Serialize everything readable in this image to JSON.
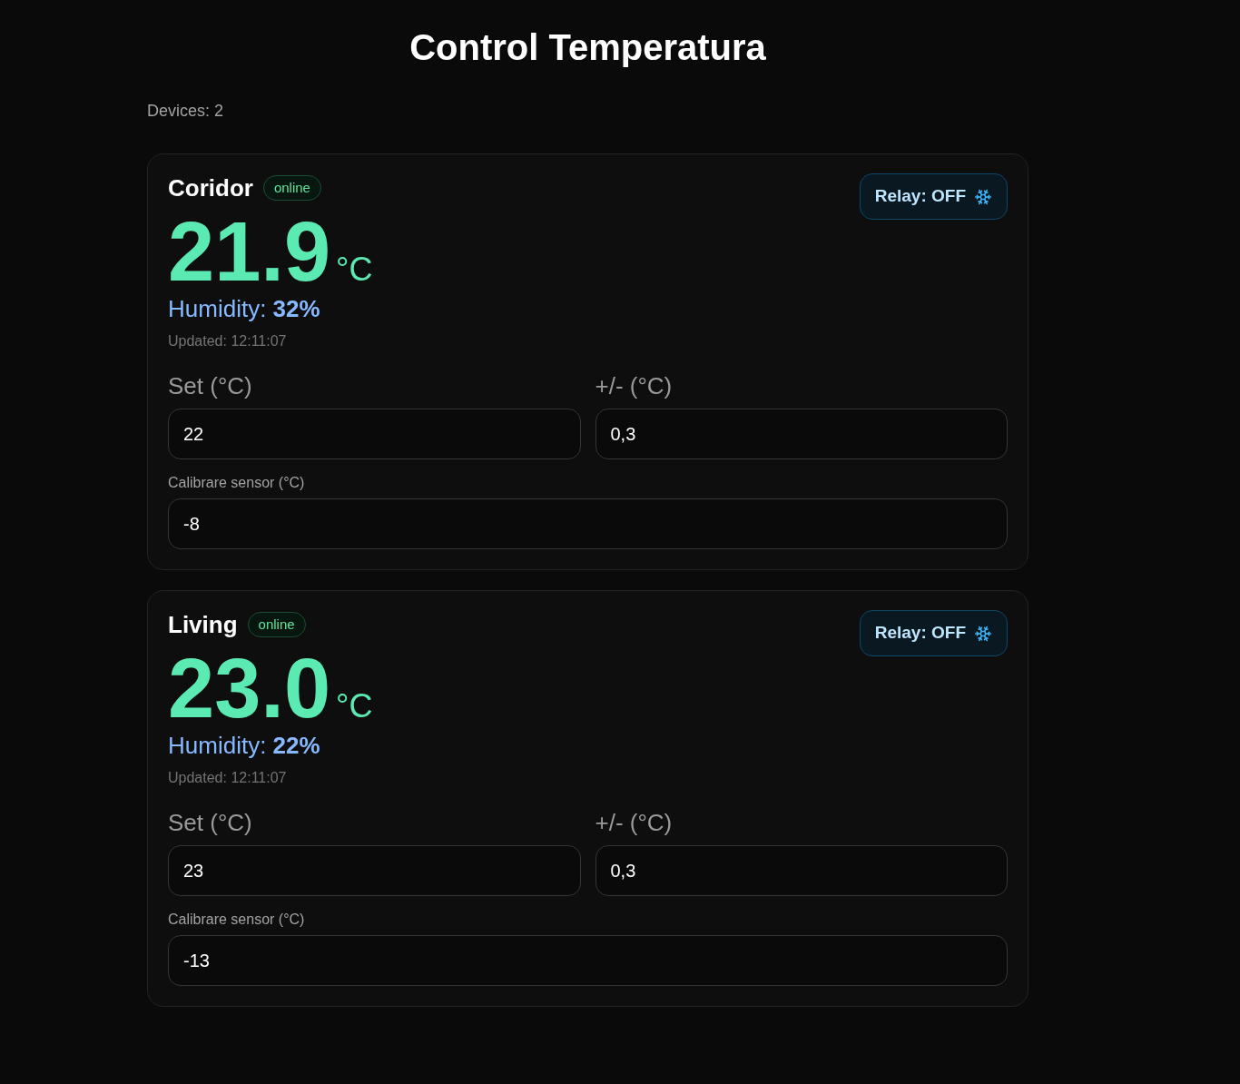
{
  "title": "Control Temperatura",
  "device_count": "Devices: 2",
  "devices": [
    {
      "name": "Coridor",
      "status": {
        "label": "online",
        "online": true
      },
      "temperature": "21.9",
      "unit": "°C",
      "humidity": "Humidity: **32%**",
      "updated": "Updated: 12:11:07",
      "relay": {
        "label": "Relay: OFF",
        "on": false
      },
      "setpoint": {
        "label": "Set (°C)",
        "value": "22"
      },
      "hysteresis": {
        "label": "+/- (°C)",
        "value": "0,3"
      },
      "calibration": {
        "label": "Calibrare sensor (°C)",
        "value": "-8"
      }
    },
    {
      "name": "Living",
      "status": {
        "label": "online",
        "online": true
      },
      "temperature": "23.0",
      "unit": "°C",
      "humidity": "Humidity: **22%**",
      "updated": "Updated: 12:11:07",
      "relay": {
        "label": "Relay: OFF",
        "on": false
      },
      "setpoint": {
        "label": "Set (°C)",
        "value": "23"
      },
      "hysteresis": {
        "label": "+/- (°C)",
        "value": "0,3"
      },
      "calibration": {
        "label": "Calibrare sensor (°C)",
        "value": "-13"
      }
    }
  ]
}
